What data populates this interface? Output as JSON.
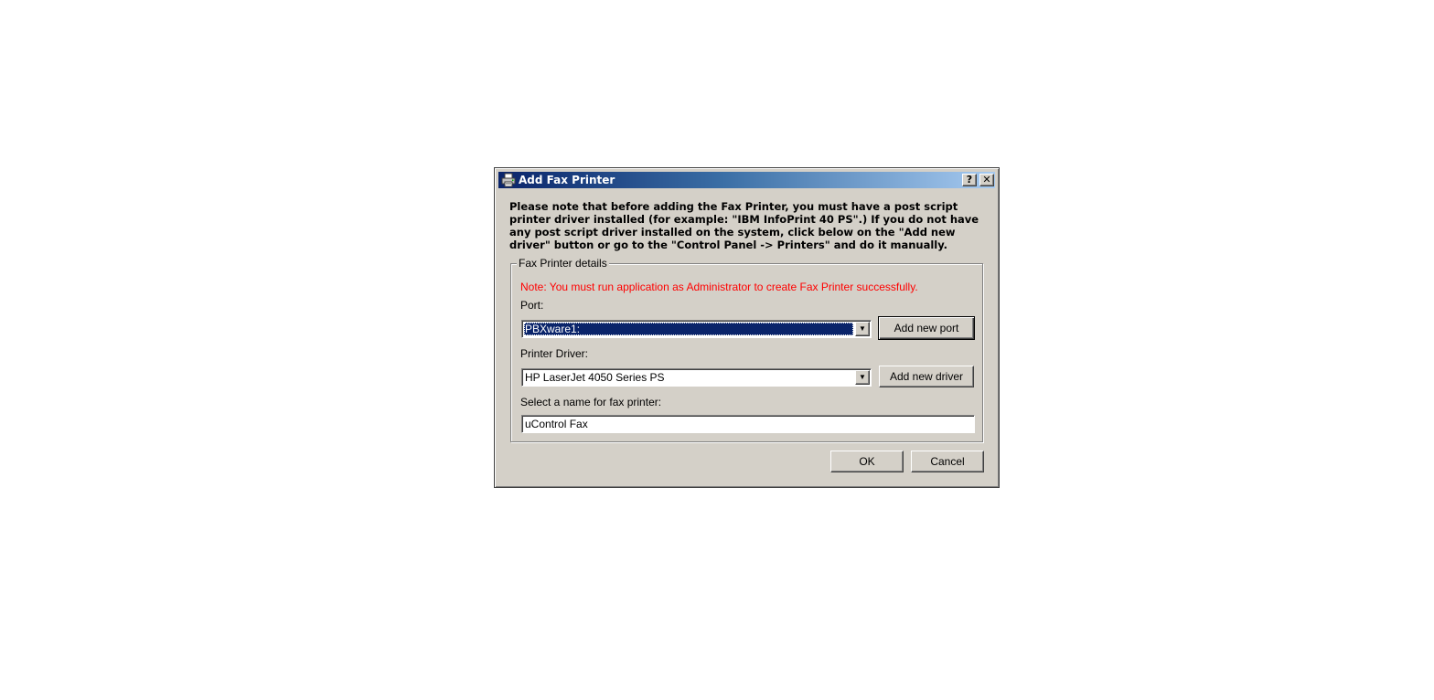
{
  "dialog": {
    "title": "Add Fax Printer",
    "help_glyph": "?",
    "close_glyph": "✕",
    "intro_text": "Please note that before adding the Fax Printer, you must have a post script printer driver installed (for example: \"IBM InfoPrint 40 PS\".) If you do not have any post script driver installed on the system, click below on the \"Add new driver\" button or go to the \"Control Panel -> Printers\" and do it manually."
  },
  "group": {
    "legend": "Fax Printer details",
    "note": "Note: You must run application as Administrator to create Fax Printer successfully.",
    "port": {
      "label": "Port:",
      "selected": "PBXware1:",
      "button_label": "Add new port"
    },
    "driver": {
      "label": "Printer Driver:",
      "selected": "HP LaserJet 4050 Series PS",
      "button_label": "Add new driver"
    },
    "name": {
      "label": "Select a name for fax printer:",
      "value": "uControl Fax"
    }
  },
  "footer": {
    "ok_label": "OK",
    "cancel_label": "Cancel"
  },
  "icons": {
    "title_icon": "printer-icon",
    "dropdown_icon": "chevron-down-icon"
  },
  "colors": {
    "title_gradient_start": "#0a246a",
    "title_gradient_end": "#a6caf0",
    "dialog_face": "#d4d0c8",
    "note_text": "#ff0000",
    "selection": "#0a246a"
  }
}
